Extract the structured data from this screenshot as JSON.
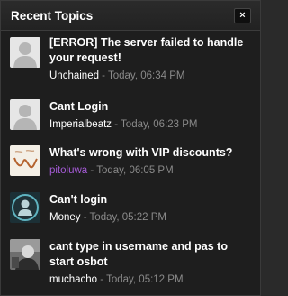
{
  "widget": {
    "title": "Recent Topics",
    "close_label": "×"
  },
  "topics": [
    {
      "title": "[ERROR] The server failed to handle your request!",
      "author": "Unchained",
      "time": " - Today, 06:34 PM",
      "avatar": "default-avatar-icon"
    },
    {
      "title": "Cant Login",
      "author": "Imperialbeatz",
      "time": " - Today, 06:23 PM",
      "avatar": "default-avatar-icon"
    },
    {
      "title": "What's wrong with VIP discounts?",
      "author": "pitoluwa",
      "time": " - Today, 06:05 PM",
      "avatar": "sketch-avatar-image",
      "author_color": "#a55bd6"
    },
    {
      "title": "Can't login",
      "author": "Money",
      "time": " - Today, 05:22 PM",
      "avatar": "circle-person-avatar-icon"
    },
    {
      "title": "cant type in username and pas to start osbot",
      "author": "muchacho",
      "time": " - Today, 05:12 PM",
      "avatar": "photo-avatar-image"
    }
  ]
}
